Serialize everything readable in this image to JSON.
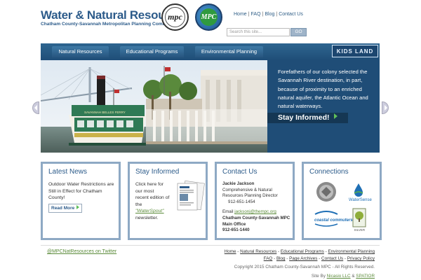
{
  "header": {
    "title": "Water & Natural Resources",
    "subtitle": "Chatham County-Savannah Metropolitan Planning Commission",
    "badge1_text": "mpc",
    "badge2_text": "MPC",
    "top_links": [
      "Home",
      "FAQ",
      "Blog",
      "Contact Us"
    ],
    "search_placeholder": "Search this site...",
    "search_button": "GO"
  },
  "nav": {
    "tabs": [
      "Natural Resources",
      "Educational Programs",
      "Environmental Planning"
    ],
    "kids_land": "KIDS LAND"
  },
  "hero": {
    "text": "Forefathers of our colony selected the Savannah River destination, in part, because of proximity to an enriched natural aquifer, the Atlantic Ocean and natural waterways.",
    "button": "Stay Informed!",
    "boat_name": "SAVANNAH BELLES FERRY"
  },
  "boxes": {
    "latest_news": {
      "title": "Latest News",
      "body": "Outdoor Water Restrictions are Still in Effect for Chatham County!",
      "button": "Read More"
    },
    "stay_informed": {
      "title": "Stay Informed",
      "line1": "Click here for",
      "line2": "our most",
      "line3": "recent edition of",
      "line4": "the",
      "link": "\"WaterSpout\"",
      "line5": "newsletter."
    },
    "contact_us": {
      "title": "Contact Us",
      "name": "Jackie Jackson",
      "role1": "Comprehensive & Natural",
      "role2": "Resources Planning Director",
      "phone1": "912-651-1454",
      "email_label": "Email",
      "email": "jacksonj@thempc.org",
      "org": "Chatham County-Savannah MPC",
      "office_label": "Main Office",
      "office_phone": "912-651-1440"
    },
    "connections": {
      "title": "Connections",
      "logos": [
        "usgbc-icon",
        "watersense-icon",
        "coastal-commuters-icon",
        "leed-silver-icon"
      ],
      "watersense_text": "WaterSense",
      "coastal_text": "coastal commuters",
      "leed_text": "SILVER"
    }
  },
  "footer": {
    "twitter": "@MPCNatResources on Twitter",
    "links_row1": [
      "Home",
      "Natural Resources",
      "Educational Programs",
      "Environmental Planning"
    ],
    "links_row2": [
      "FAQ",
      "Blog",
      "Page Archives",
      "Contact Us",
      "Privacy Policy"
    ],
    "copyright": "Copyright 2015 Chatham County-Savannah MPC - All Rights Reserved.",
    "site_by_label": "Site By",
    "site_by_1": "Nicasio LLC",
    "site_by_amp": "&",
    "site_by_2": "SPATIOR"
  },
  "colors": {
    "brand_blue": "#2c5b8a",
    "nav_blue": "#1f4e78",
    "accent_green": "#5fbf5a",
    "box_border": "#8ea9c4"
  }
}
